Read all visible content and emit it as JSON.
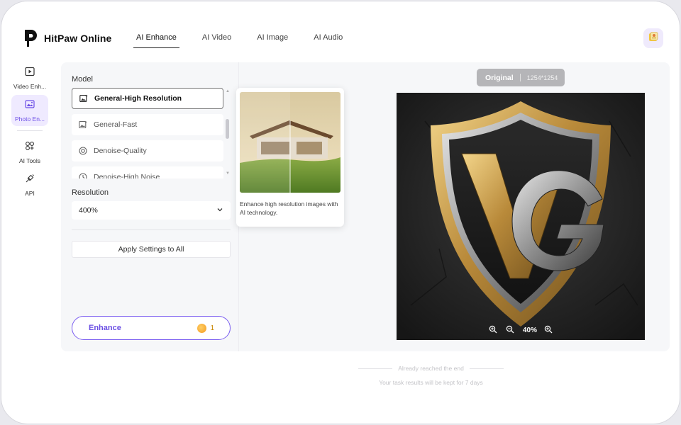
{
  "app": {
    "name": "HitPaw Online"
  },
  "nav": {
    "tabs": [
      "AI Enhance",
      "AI Video",
      "AI Image",
      "AI Audio"
    ],
    "active": "AI Enhance"
  },
  "sidebar": {
    "items": [
      {
        "label": "Video Enh...",
        "icon": "video-enhance-icon"
      },
      {
        "label": "Photo En...",
        "icon": "photo-enhance-icon",
        "active": true
      },
      {
        "label": "AI Tools",
        "icon": "ai-tools-icon"
      },
      {
        "label": "API",
        "icon": "api-icon"
      }
    ]
  },
  "settings": {
    "model_label": "Model",
    "models": [
      "General-High  Resolution",
      "General-Fast",
      "Denoise-Quality",
      "Denoise-High Noise"
    ],
    "selected_model": "General-High  Resolution",
    "resolution_label": "Resolution",
    "resolution_value": "400%",
    "apply_label": "Apply Settings to All",
    "enhance_label": "Enhance",
    "credits": "1"
  },
  "tooltip": {
    "description": "Enhance high resolution images with AI technology."
  },
  "preview": {
    "badge_label": "Original",
    "dimensions": "1254*1254",
    "zoom": "40%"
  },
  "footer": {
    "end_text": "Already reached the end",
    "retention_text": "Your task results will be kept for 7 days"
  },
  "colors": {
    "accent": "#6a4ee3",
    "panel_bg": "#f6f7f9",
    "badge_bg": "#b5b5b8"
  }
}
